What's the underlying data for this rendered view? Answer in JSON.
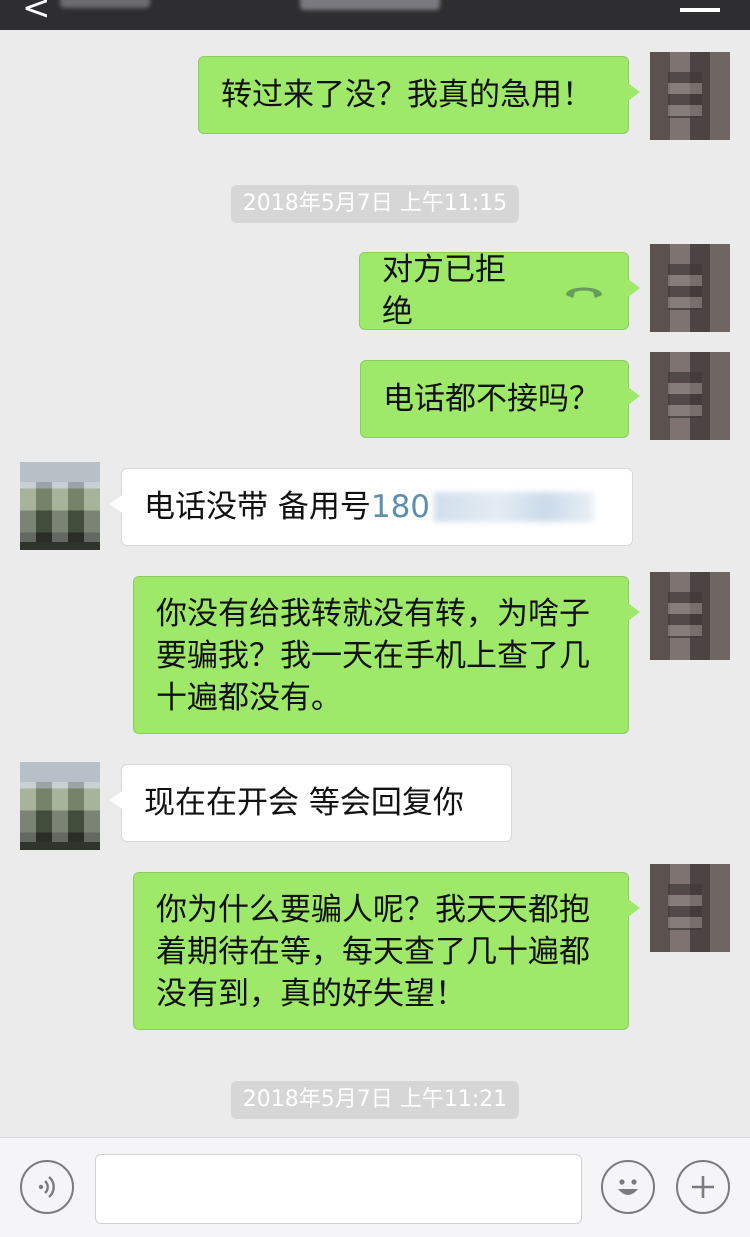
{
  "topbar": {
    "back_symbol": "<"
  },
  "messages": [
    {
      "side": "right",
      "text": "转过来了没？我真的急用！"
    },
    {
      "side": "right",
      "text": "对方已拒绝",
      "icon": "phone-hangup-icon"
    },
    {
      "side": "right",
      "text": "电话都不接吗？"
    },
    {
      "side": "left",
      "text_prefix": "电话没带  备用号",
      "number_visible": "180"
    },
    {
      "side": "right",
      "lines": [
        "你没有给我转就没有转，为啥子",
        "要骗我？我一天在手机上查了几",
        "十遍都没有。"
      ]
    },
    {
      "side": "left",
      "text": "现在在开会  等会回复你"
    },
    {
      "side": "right",
      "lines": [
        "你为什么要骗人呢？我天天都抱",
        "着期待在等，每天查了几十遍都",
        "没有到，真的好失望！"
      ]
    }
  ],
  "timestamps": [
    "2018年5月7日 上午11:15",
    "2018年5月7日 上午11:21"
  ],
  "bottom_bar": {
    "voice_icon": "voice-icon",
    "emoji_icon": "emoji-icon",
    "add_icon": "add-icon"
  },
  "colors": {
    "bubble_green": "#9ee86a",
    "bubble_white": "#ffffff",
    "background": "#ebebeb"
  }
}
